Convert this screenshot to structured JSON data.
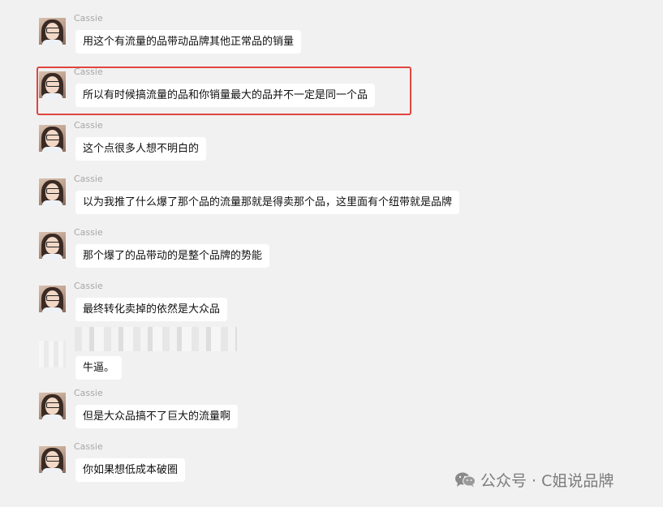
{
  "messages": [
    {
      "sender": "Cassie",
      "text": "用这个有流量的品带动品牌其他正常品的销量"
    },
    {
      "sender": "Cassie",
      "text": "所以有时候搞流量的品和你销量最大的品并不一定是同一个品"
    },
    {
      "sender": "Cassie",
      "text": "这个点很多人想不明白的"
    },
    {
      "sender": "Cassie",
      "text": "以为我推了什么爆了那个品的流量那就是得卖那个品，这里面有个纽带就是品牌"
    },
    {
      "sender": "Cassie",
      "text": "那个爆了的品带动的是整个品牌的势能"
    },
    {
      "sender": "Cassie",
      "text": "最终转化卖掉的依然是大众品"
    },
    {
      "sender": "",
      "text": "牛逼。"
    },
    {
      "sender": "Cassie",
      "text": "但是大众品搞不了巨大的流量啊"
    },
    {
      "sender": "Cassie",
      "text": "你如果想低成本破圈"
    }
  ],
  "watermark": {
    "text": "公众号 · C姐说品牌",
    "icon": "wechat-icon"
  }
}
